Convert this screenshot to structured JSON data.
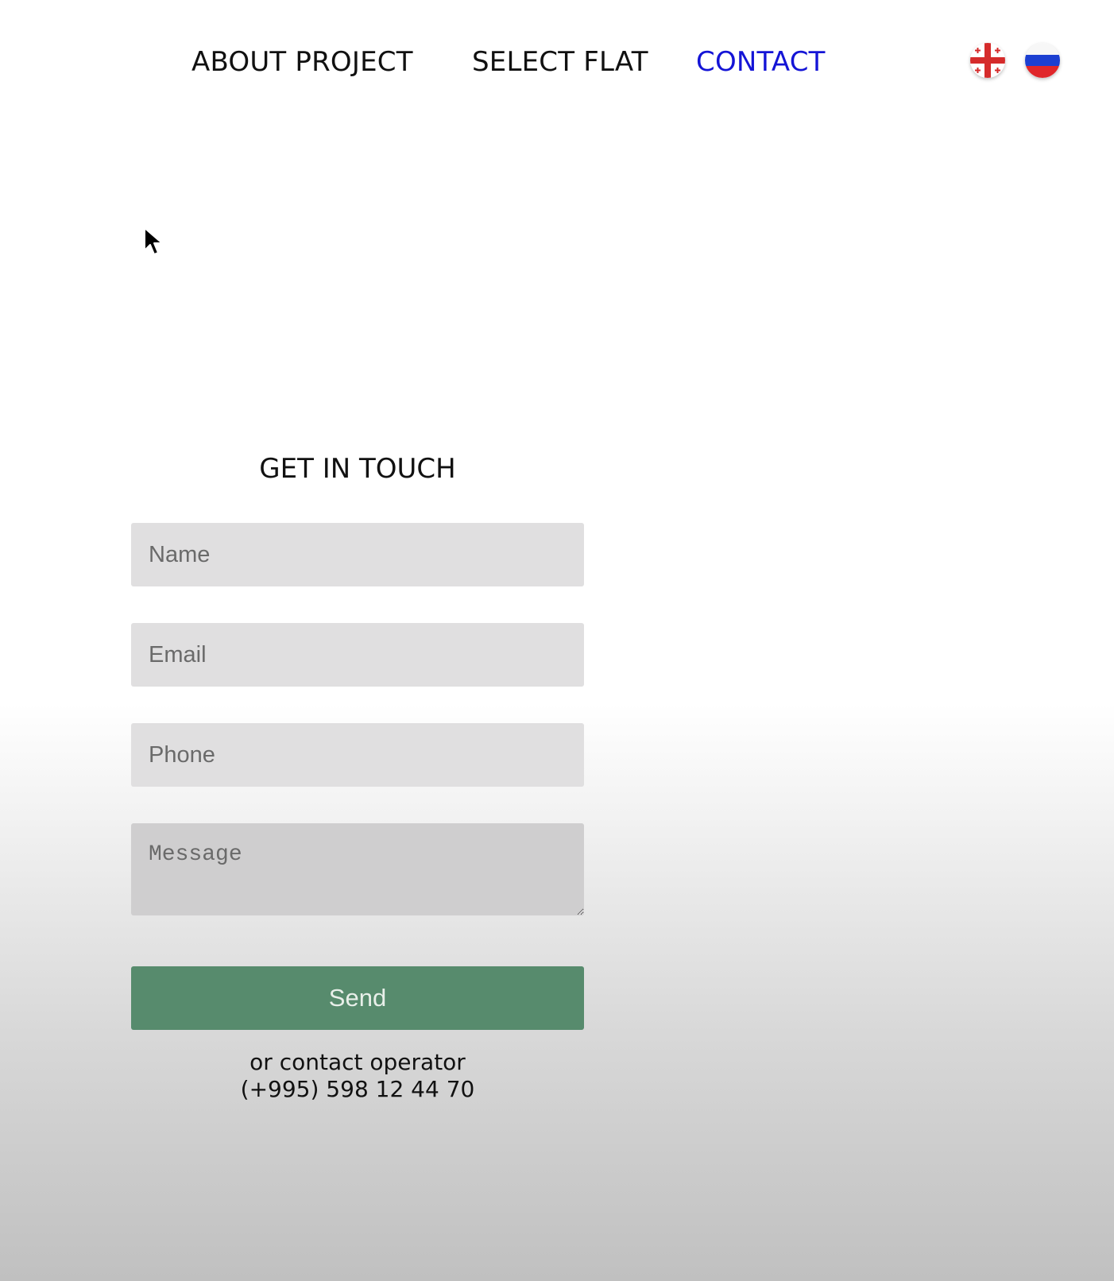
{
  "nav": {
    "items": [
      {
        "label": "ABOUT PROJECT",
        "active": false
      },
      {
        "label": "SELECT FLAT",
        "active": false
      },
      {
        "label": "CONTACT",
        "active": true
      }
    ],
    "active_color": "#1414d6",
    "languages": [
      {
        "icon": "georgia-flag-icon"
      },
      {
        "icon": "russia-flag-icon"
      }
    ]
  },
  "contact_form": {
    "title": "GET IN TOUCH",
    "name_placeholder": "Name",
    "email_placeholder": "Email",
    "phone_placeholder": "Phone",
    "message_placeholder": "Message",
    "send_label": "Send",
    "send_color": "#578b6d",
    "operator_line1": "or contact operator",
    "operator_phone": "(+995) 598 12 44 70"
  }
}
